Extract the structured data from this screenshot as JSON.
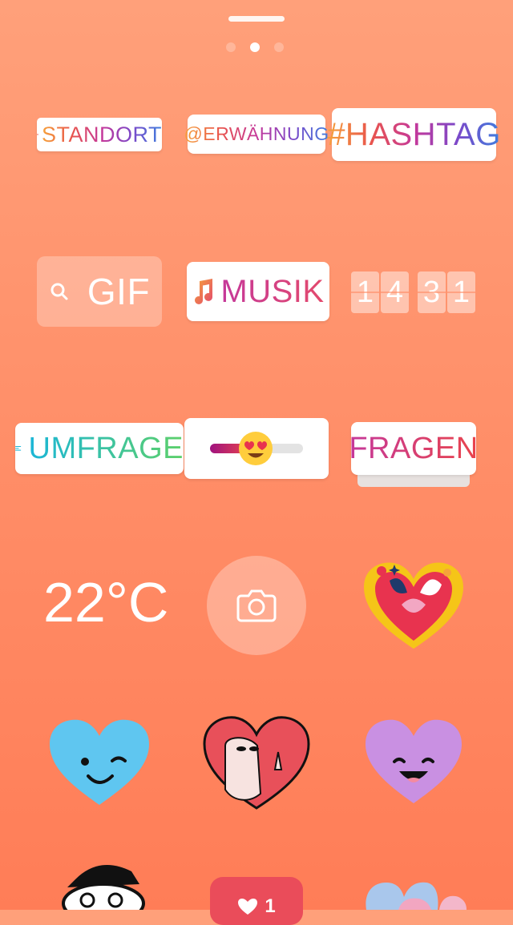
{
  "top": {
    "page_dots": 3,
    "active_dot": 1
  },
  "stickers": {
    "standort": "STANDORT",
    "erwaehnung": "@ERWÄHNUNG",
    "hashtag": "#HASHTAG",
    "gif": "GIF",
    "musik": "MUSIK",
    "countdown_digits": [
      "1",
      "4",
      "3",
      "1"
    ],
    "umfrage": "UMFRAGE",
    "fragen": "FRAGEN",
    "temperature": "22°C",
    "like_count": "1"
  },
  "icons": {
    "location": "location-pin-icon",
    "search": "search-icon",
    "music": "music-note-icon",
    "poll": "poll-lines-icon",
    "slider_emoji": "heart-eyes-emoji-icon",
    "camera": "camera-icon"
  },
  "colors": {
    "background_top": "#FFA07A",
    "background_bottom": "#FF7D57",
    "white": "#FFFFFF"
  }
}
